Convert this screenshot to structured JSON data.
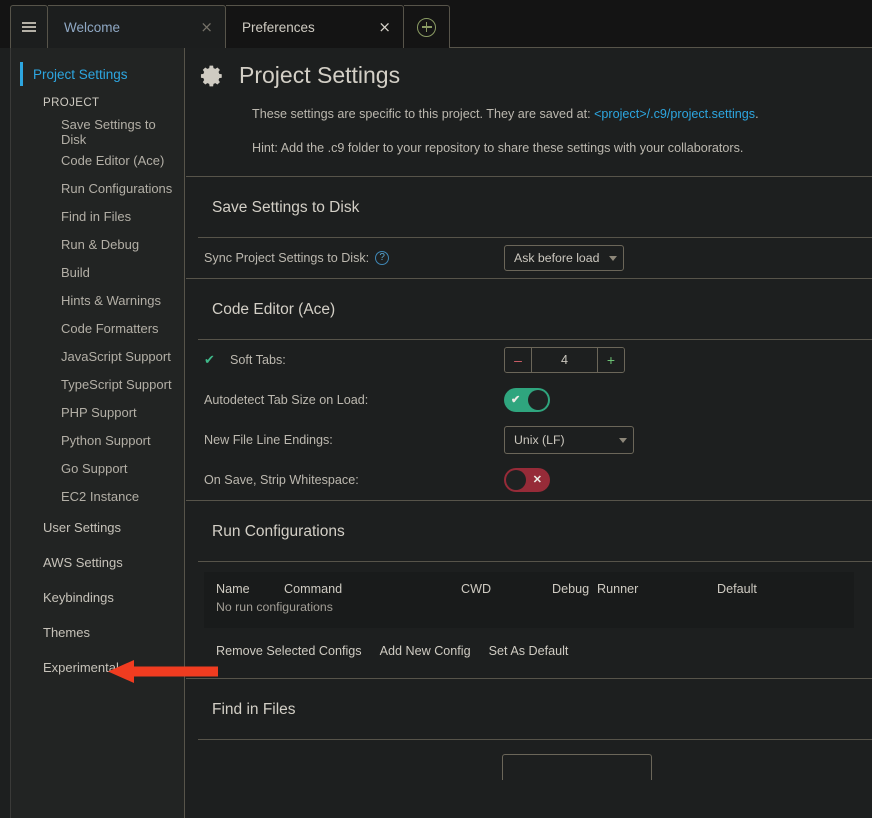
{
  "window": {
    "menu_icon": "hamburger-icon",
    "new_tab_icon": "plus-circle-icon"
  },
  "tabs": [
    {
      "label": "Welcome",
      "close": "×",
      "active": true
    },
    {
      "label": "Preferences",
      "close": "×",
      "active": false
    }
  ],
  "sidebar": {
    "items": [
      {
        "label": "Project Settings",
        "level": "root"
      },
      {
        "label": "PROJECT",
        "level": "group"
      },
      {
        "label": "Save Settings to Disk",
        "level": "child"
      },
      {
        "label": "Code Editor (Ace)",
        "level": "child"
      },
      {
        "label": "Run Configurations",
        "level": "child"
      },
      {
        "label": "Find in Files",
        "level": "child"
      },
      {
        "label": "Run & Debug",
        "level": "child"
      },
      {
        "label": "Build",
        "level": "child"
      },
      {
        "label": "Hints & Warnings",
        "level": "child"
      },
      {
        "label": "Code Formatters",
        "level": "child"
      },
      {
        "label": "JavaScript Support",
        "level": "child"
      },
      {
        "label": "TypeScript Support",
        "level": "child"
      },
      {
        "label": "PHP Support",
        "level": "child"
      },
      {
        "label": "Python Support",
        "level": "child"
      },
      {
        "label": "Go Support",
        "level": "child"
      },
      {
        "label": "EC2 Instance",
        "level": "child"
      },
      {
        "label": "User Settings",
        "level": "section"
      },
      {
        "label": "AWS Settings",
        "level": "section"
      },
      {
        "label": "Keybindings",
        "level": "section"
      },
      {
        "label": "Themes",
        "level": "section"
      },
      {
        "label": "Experimental",
        "level": "section"
      }
    ]
  },
  "header": {
    "icon": "gear-icon",
    "title": "Project Settings",
    "desc_prefix": "These settings are specific to this project. They are saved at: ",
    "desc_link": "<project>/.c9/project.settings",
    "desc_suffix": ".",
    "hint": "Hint: Add the .c9 folder to your repository to share these settings with your collaborators."
  },
  "sections": {
    "save_settings": {
      "title": "Save Settings to Disk",
      "sync_label": "Sync Project Settings to Disk:",
      "help_glyph": "?",
      "sync_value": "Ask before load"
    },
    "code_editor": {
      "title": "Code Editor (Ace)",
      "soft_tabs_label": "Soft Tabs:",
      "soft_tabs_checked": "✔",
      "tab_size_minus": "–",
      "tab_size_value": "4",
      "tab_size_plus": "+",
      "autodetect_label": "Autodetect Tab Size on Load:",
      "autodetect_state": "on",
      "autodetect_glyph": "✔",
      "line_endings_label": "New File Line Endings:",
      "line_endings_value": "Unix (LF)",
      "strip_ws_label": "On Save, Strip Whitespace:",
      "strip_ws_state": "off",
      "strip_ws_glyph": "✕"
    },
    "run_configs": {
      "title": "Run Configurations",
      "columns": [
        "Name",
        "Command",
        "CWD",
        "Debug",
        "Runner",
        "Default"
      ],
      "empty_text": "No run configurations",
      "actions": [
        "Remove Selected Configs",
        "Add New Config",
        "Set As Default"
      ]
    },
    "find_in_files": {
      "title": "Find in Files"
    }
  },
  "annotation": {
    "arrow_color": "#f03c20",
    "points_to": "Experimental"
  },
  "colors": {
    "accent_blue": "#2da6e0",
    "toggle_on": "#2fa57e",
    "toggle_off": "#962b38",
    "border": "#57544a",
    "panel_bg": "#1d1f1f",
    "sidebar_bg": "#222423"
  }
}
